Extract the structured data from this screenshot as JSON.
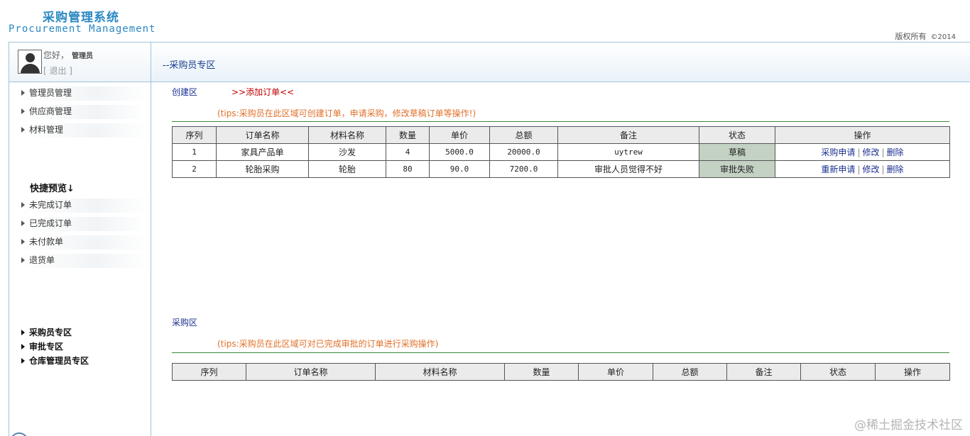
{
  "header": {
    "title_cn": "采购管理系统",
    "title_en": "Procurement Management",
    "copyright": "版权所有",
    "year": "©2014"
  },
  "user": {
    "greeting": "您好，",
    "name": "管理员",
    "logout": "[ 退出 ]"
  },
  "page_title": "--采购员专区",
  "sidebar": {
    "items": [
      {
        "label": "管理员管理"
      },
      {
        "label": "供应商管理"
      },
      {
        "label": "材料管理"
      }
    ],
    "quick_title": "快捷预览↓",
    "quick_items": [
      {
        "label": "未完成订单"
      },
      {
        "label": "已完成订单"
      },
      {
        "label": "未付款单"
      },
      {
        "label": "退货单"
      }
    ],
    "zones": [
      {
        "label": "采购员专区"
      },
      {
        "label": "审批专区"
      },
      {
        "label": "仓库管理员专区"
      }
    ]
  },
  "create": {
    "label": "创建区",
    "add_link": ">>添加订单<<",
    "tips": "(tips:采购员在此区域可创建订单，申请采购，修改草稿订单等操作!)",
    "columns": [
      "序列",
      "订单名称",
      "材料名称",
      "数量",
      "单价",
      "总额",
      "备注",
      "状态",
      "操作"
    ],
    "rows": [
      {
        "seq": "1",
        "order": "家具产品单",
        "material": "沙发",
        "qty": "4",
        "price": "5000.0",
        "total": "20000.0",
        "note": "uytrew",
        "status": "草稿",
        "op1": "采购申请",
        "op2": "修改",
        "op3": "删除"
      },
      {
        "seq": "2",
        "order": "轮胎采购",
        "material": "轮胎",
        "qty": "80",
        "price": "90.0",
        "total": "7200.0",
        "note": "审批人员觉得不好",
        "status": "审批失败",
        "op1": "重新申请",
        "op2": "修改",
        "op3": "删除"
      }
    ]
  },
  "purchase": {
    "label": "采购区",
    "tips": "(tips:采购员在此区域可对已完成审批的订单进行采购操作)",
    "columns": [
      "序列",
      "订单名称",
      "材料名称",
      "数量",
      "单价",
      "总额",
      "备注",
      "状态",
      "操作"
    ]
  },
  "watermark": "@稀土掘金技术社区",
  "colors": {
    "brand": "#2b88c2",
    "link": "#1a2f8f",
    "tips": "#e0702a",
    "status_bg": "#c4d2c4"
  }
}
